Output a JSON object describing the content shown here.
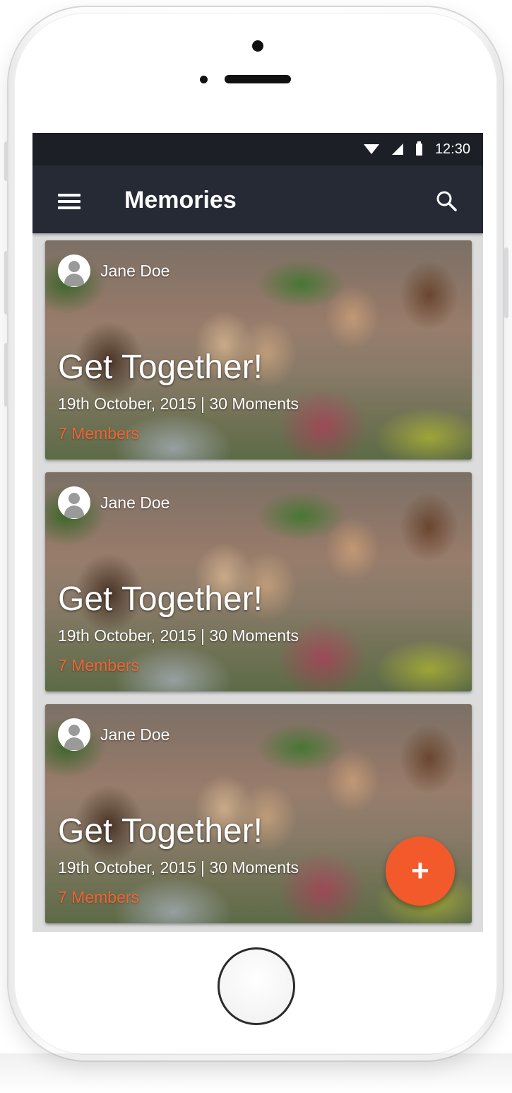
{
  "status_bar": {
    "time": "12:30"
  },
  "app_bar": {
    "title": "Memories"
  },
  "icons": {
    "menu": "hamburger-menu-icon",
    "search": "search-icon",
    "add": "plus-icon",
    "avatar": "user-avatar-icon"
  },
  "colors": {
    "app_bar": "#252a35",
    "status_bar": "#1c1f26",
    "accent": "#f2592b",
    "members_text": "#f26334"
  },
  "cards": [
    {
      "author": "Jane Doe",
      "title": "Get Together!",
      "meta": "19th October, 2015 | 30 Moments",
      "members": "7 Members"
    },
    {
      "author": "Jane Doe",
      "title": "Get Together!",
      "meta": "19th October, 2015 | 30 Moments",
      "members": "7 Members"
    },
    {
      "author": "Jane Doe",
      "title": "Get Together!",
      "meta": "19th October, 2015 | 30 Moments",
      "members": "7 Members"
    }
  ],
  "fab": {
    "label": "+"
  }
}
